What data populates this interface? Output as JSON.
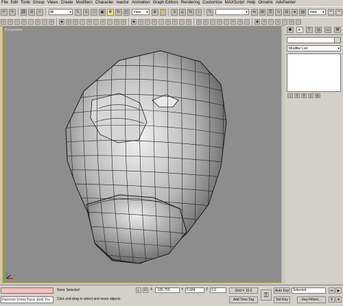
{
  "menu": [
    "File",
    "Edit",
    "Tools",
    "Group",
    "Views",
    "Create",
    "Modifiers",
    "Character",
    "reactor",
    "Animation",
    "Graph Editors",
    "Rendering",
    "Customize",
    "MAXScript",
    "Help",
    "Ornatrix",
    "AdvPainter"
  ],
  "toolbar": {
    "selection_filter": "All",
    "ref_coord": "View",
    "named_selection": "",
    "view_dropdown": "View"
  },
  "viewport": {
    "label": "Perspective"
  },
  "command_panel": {
    "modifier_list": "Modifier List",
    "object_name": ""
  },
  "status": {
    "script_listener": "PainterInterface End Fu",
    "selection_status": "None Selected",
    "prompt": "Click and drag to select and move objects",
    "x_label": "X",
    "x_value": "-105.755",
    "y_label": "Y",
    "y_value": "5.684",
    "z_label": "Z",
    "z_value": "0.0",
    "grid": "Grid = 10.0",
    "add_time_tag": "Add Time Tag",
    "auto_key": "Auto Key",
    "set_key": "Set Key",
    "key_mode": "Selected",
    "key_filters": "Key Filters..."
  },
  "colors": {
    "viewport_bg": "#8d8d8d",
    "active_border": "#e0c000",
    "ui_gray": "#d4d0c8"
  }
}
